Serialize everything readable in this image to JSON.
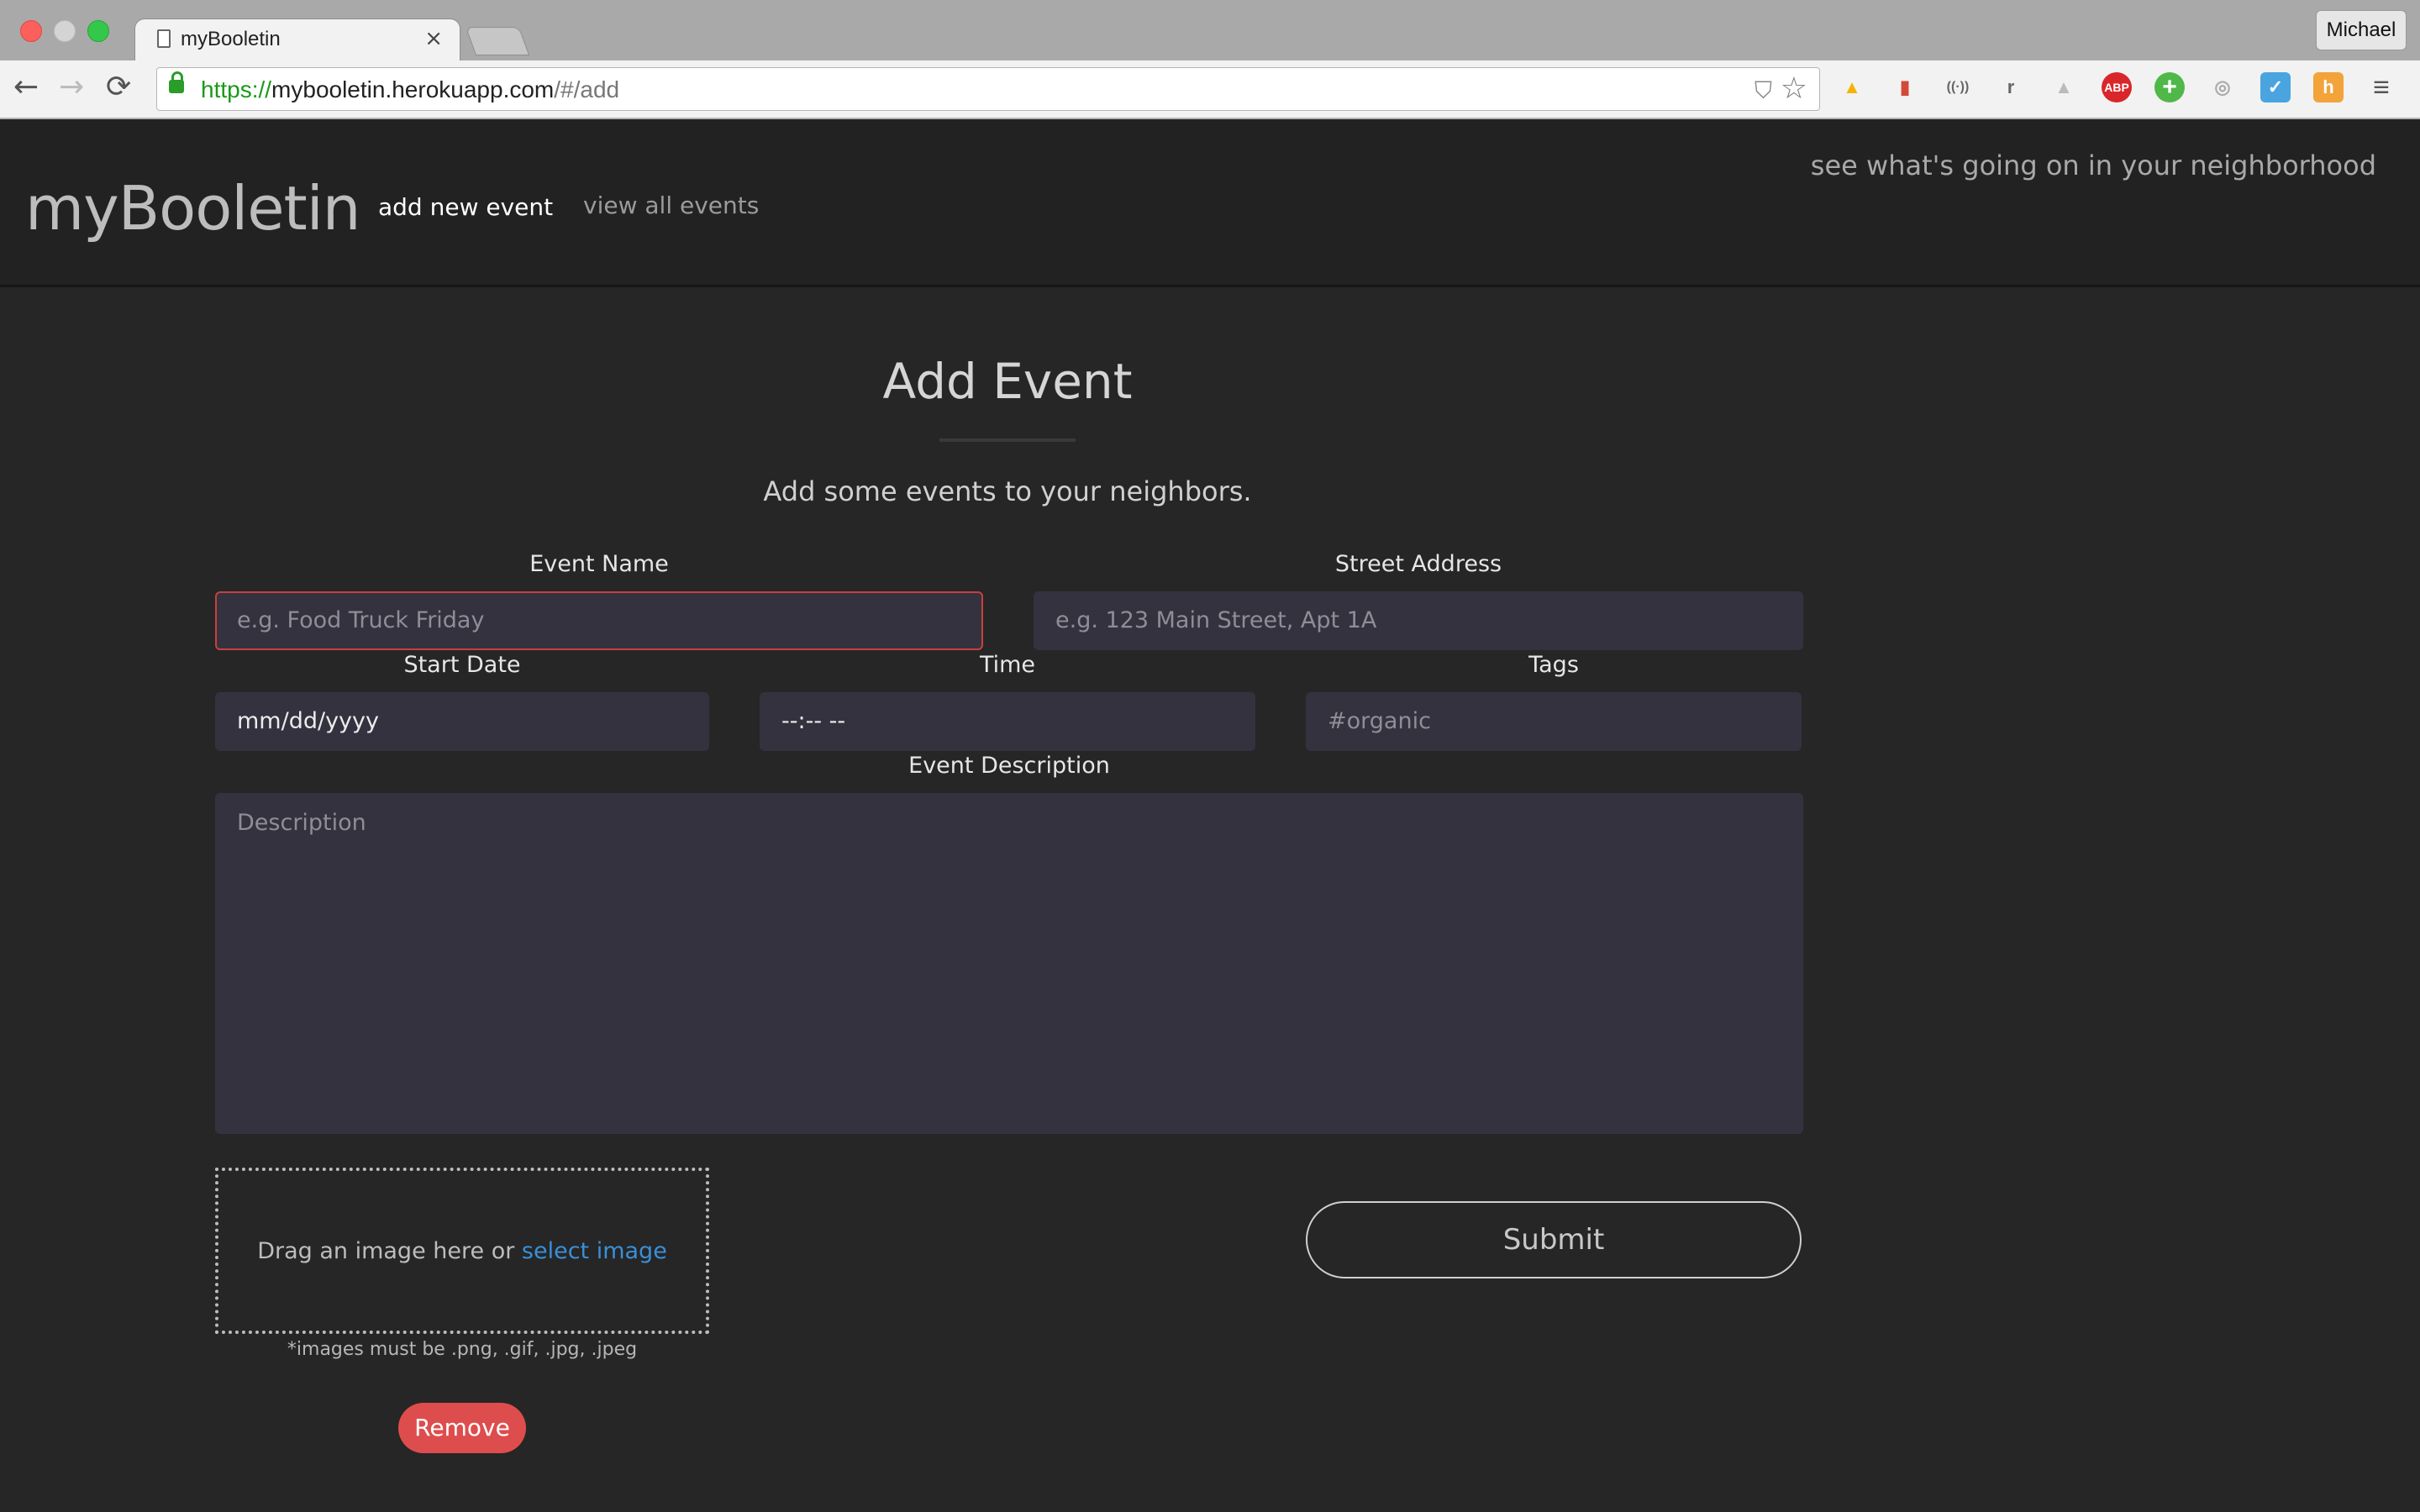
{
  "browser": {
    "tab_title": "myBooletin",
    "tab_close": "×",
    "profile_name": "Michael",
    "url_scheme": "https://",
    "url_host": "mybooletin.herokuapp.com",
    "url_path": "/#/add",
    "nav": {
      "back": "←",
      "forward": "→",
      "reload": "⟳"
    },
    "extensions": [
      {
        "name": "google-drive-icon",
        "glyph": "▲",
        "color": "#f4b400"
      },
      {
        "name": "bookmark-extension-icon",
        "glyph": "▮",
        "color": "#d24a3a"
      },
      {
        "name": "wireless-icon",
        "glyph": "((·))",
        "color": "#666666"
      },
      {
        "name": "readability-icon",
        "glyph": "r",
        "color": "#666666"
      },
      {
        "name": "drive-gray-icon",
        "glyph": "▲",
        "color": "#bbbbbb"
      },
      {
        "name": "adblock-plus-icon",
        "glyph": "ABP",
        "color": "#d9262a"
      },
      {
        "name": "plus-extension-icon",
        "glyph": "+",
        "color": "#4fb848"
      },
      {
        "name": "circle-extension-icon",
        "glyph": "◎",
        "color": "#aaaaaa"
      },
      {
        "name": "checkmark-extension-icon",
        "glyph": "✓",
        "color": "#4aa4e0"
      },
      {
        "name": "honey-extension-icon",
        "glyph": "h",
        "color": "#f2a33a"
      },
      {
        "name": "menu-icon",
        "glyph": "≡",
        "color": "#555555"
      }
    ]
  },
  "header": {
    "brand": "myBooletin",
    "nav_add": "add new event",
    "nav_view": "view all events",
    "tagline": "see what's going on in your neighborhood"
  },
  "form": {
    "title": "Add Event",
    "subtitle": "Add some events to your neighbors.",
    "event_name": {
      "label": "Event Name",
      "placeholder": "e.g. Food Truck Friday"
    },
    "street_address": {
      "label": "Street Address",
      "placeholder": "e.g. 123 Main Street, Apt 1A"
    },
    "start_date": {
      "label": "Start Date",
      "value": "mm/dd/yyyy"
    },
    "time": {
      "label": "Time",
      "value": "--:-- --"
    },
    "tags": {
      "label": "Tags",
      "placeholder": "#organic"
    },
    "description": {
      "label": "Event Description",
      "placeholder": "Description"
    },
    "dropzone_text": "Drag an image here or ",
    "dropzone_link": "select image",
    "dropzone_note": "*images must be .png, .gif, .jpg, .jpeg",
    "remove_label": "Remove",
    "submit_label": "Submit"
  }
}
